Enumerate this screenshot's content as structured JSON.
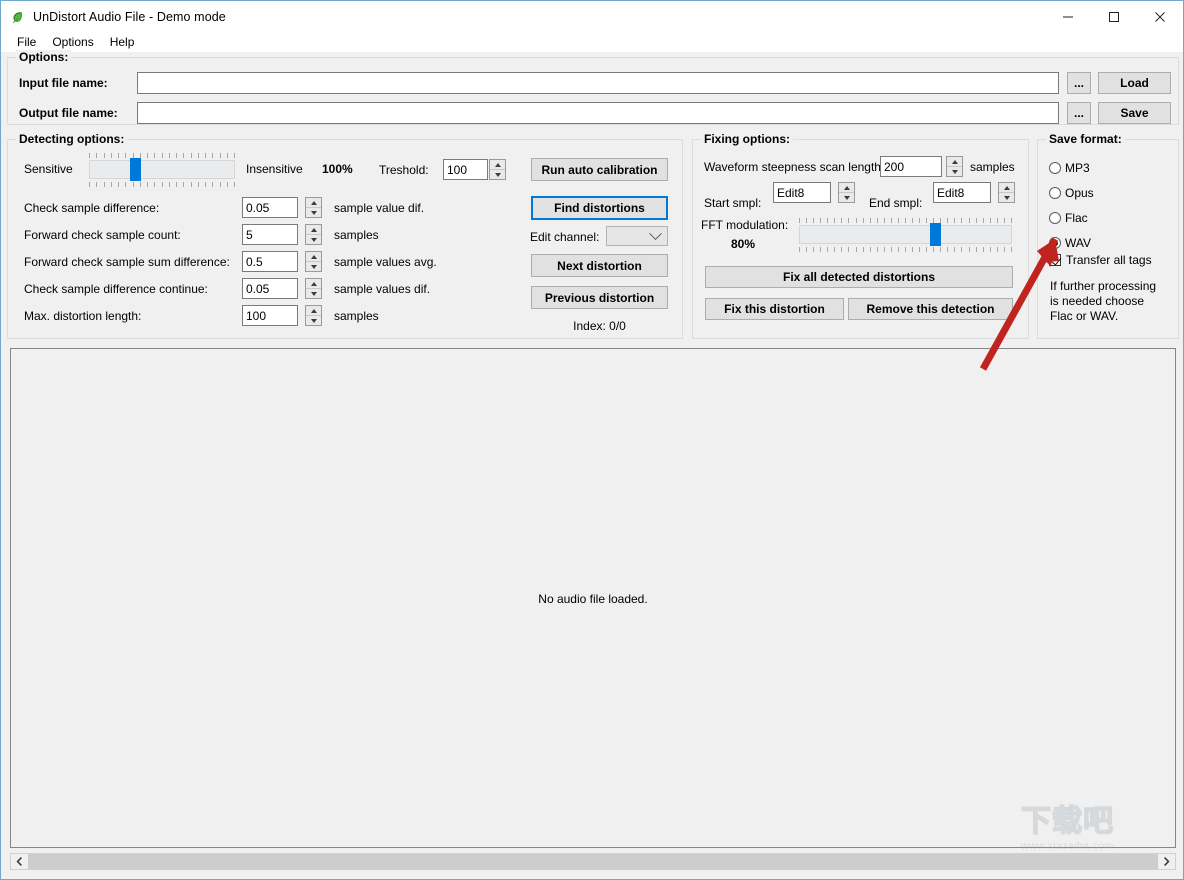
{
  "window": {
    "title": "UnDistort Audio File - Demo mode",
    "icon": "leaf-icon",
    "controls": {
      "minimize": "–",
      "maximize": "□",
      "close": "✕"
    }
  },
  "menubar": {
    "items": [
      "File",
      "Options",
      "Help"
    ]
  },
  "options_group": {
    "legend": "Options:",
    "input_label": "Input file name:",
    "input_value": "",
    "input_placeholder": "",
    "output_label": "Output file name:",
    "output_value": "",
    "output_placeholder": "",
    "browse_label": "...",
    "load_label": "Load",
    "save_label": "Save"
  },
  "detecting": {
    "legend": "Detecting options:",
    "sensitive_label": "Sensitive",
    "insensitive_label": "Insensitive",
    "percent": "100%",
    "slider_value": 30,
    "threshold_label": "Treshold:",
    "threshold_value": "100",
    "fields": [
      {
        "label": "Check sample difference:",
        "value": "0.05",
        "unit": "sample value dif."
      },
      {
        "label": "Forward check sample count:",
        "value": "5",
        "unit": "samples"
      },
      {
        "label": "Forward check sample sum difference:",
        "value": "0.5",
        "unit": "sample values avg."
      },
      {
        "label": "Check sample difference continue:",
        "value": "0.05",
        "unit": "sample values dif."
      },
      {
        "label": "Max. distortion length:",
        "value": "100",
        "unit": "samples"
      }
    ],
    "run_auto_calibration": "Run auto calibration",
    "find_distortions": "Find distortions",
    "edit_channel_label": "Edit channel:",
    "edit_channel_value": "",
    "next_distortion": "Next distortion",
    "previous_distortion": "Previous distortion",
    "index_label": "Index: 0/0"
  },
  "fixing": {
    "legend": "Fixing options:",
    "scan_length_label": "Waveform steepness scan length:",
    "scan_length_value": "200",
    "scan_length_unit": "samples",
    "start_label": "Start smpl:",
    "start_value": "Edit8",
    "end_label": "End smpl:",
    "end_value": "Edit8",
    "fft_label": "FFT modulation:",
    "fft_percent": "80%",
    "fft_slider_value": 65,
    "fix_all": "Fix all detected distortions",
    "fix_this": "Fix this distortion",
    "remove_this": "Remove this detection"
  },
  "save_format": {
    "legend": "Save format:",
    "options": [
      {
        "label": "MP3",
        "selected": false
      },
      {
        "label": "Opus",
        "selected": false
      },
      {
        "label": "Flac",
        "selected": false
      },
      {
        "label": "WAV",
        "selected": true
      }
    ],
    "transfer_tags_label": "Transfer all tags",
    "transfer_tags_checked": true,
    "hint": "If further processing is needed choose Flac or WAV."
  },
  "canvas": {
    "message": "No audio file loaded.",
    "scroll_left": "‹",
    "scroll_right": "›"
  },
  "watermark": {
    "cn": "下载吧",
    "url": "www.xiazaiba.com"
  },
  "colors": {
    "accent": "#0078d7",
    "window_bg": "#f0f0f0",
    "border": "#6fa8c9",
    "annotation_arrow": "#c0241f"
  }
}
